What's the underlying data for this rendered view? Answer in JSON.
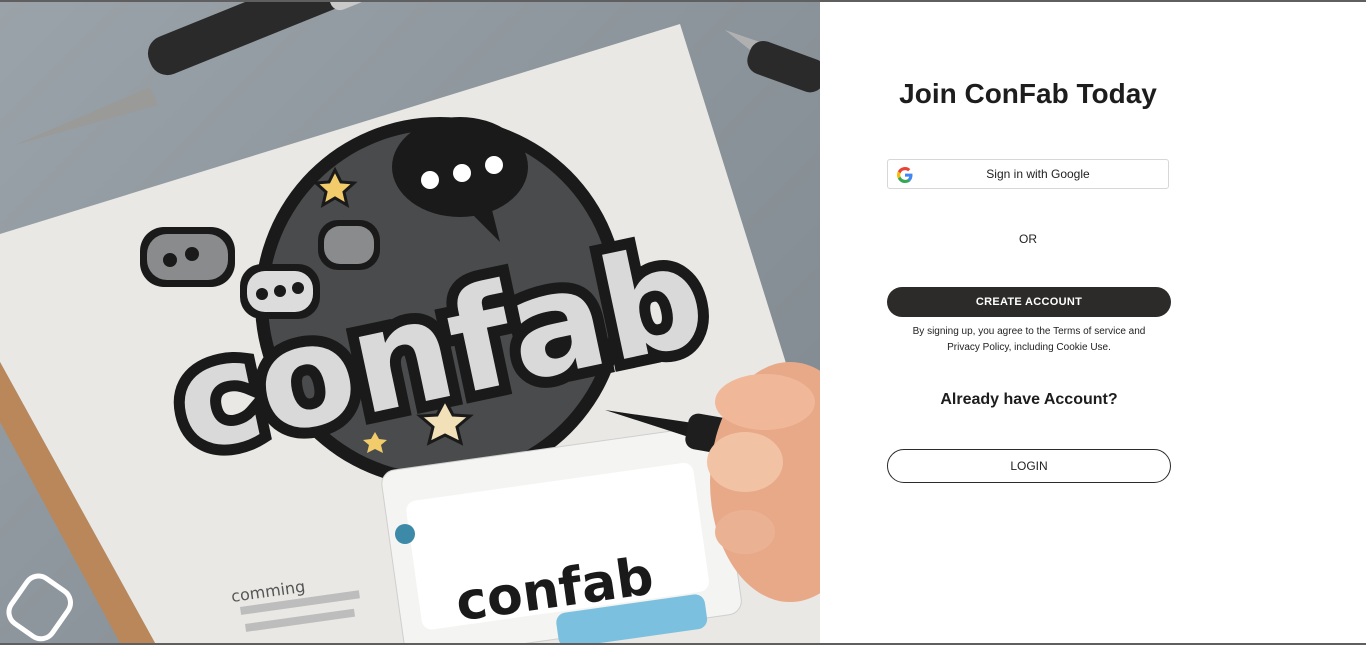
{
  "hero": {
    "logo_text": "confab",
    "small_logo_text": "confab",
    "sketch_text": "comming"
  },
  "signup": {
    "title": "Join ConFab Today",
    "google_label": "Sign in with Google",
    "divider": "OR",
    "create_label": "CREATE ACCOUNT",
    "terms_line1": "By signing up, you agree to the Terms of service and",
    "terms_line2": "Privacy Policy, including Cookie Use.",
    "already_label": "Already have Account?",
    "login_label": "LOGIN"
  },
  "colors": {
    "primary_dark": "#2c2b29",
    "hero_bg": "#8d969c"
  }
}
